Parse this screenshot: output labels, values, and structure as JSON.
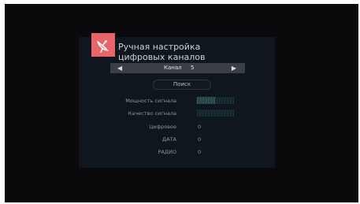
{
  "title": {
    "line1": "Ручная настройка",
    "line2": "цифровых каналов",
    "icon": "satellite-dish-icon",
    "icon_color": "#e86469"
  },
  "channel": {
    "label": "Канал",
    "value": "5"
  },
  "search_button": "Поиск",
  "signal": {
    "strength_label": "Мощность сигнала",
    "strength_level": 0.5,
    "quality_label": "Качество сигнала",
    "quality_level": 0.0
  },
  "counts": {
    "digital_label": "Цифровое",
    "digital_value": "0",
    "data_label": "ДАТА",
    "data_value": "0",
    "radio_label": "РАДИО",
    "radio_value": "0"
  }
}
